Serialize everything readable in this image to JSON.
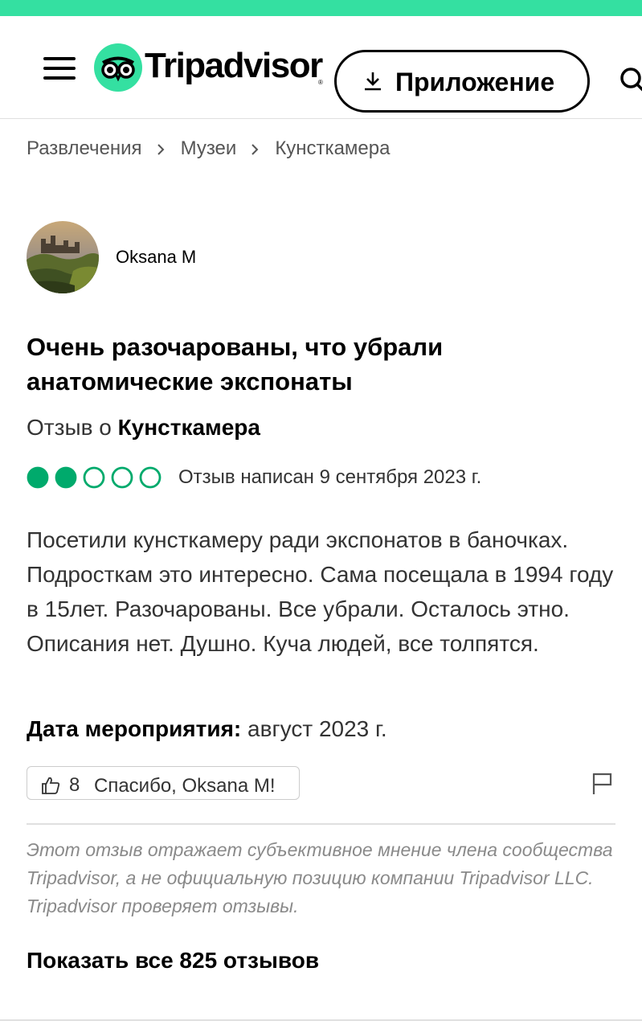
{
  "header": {
    "brand_name": "Tripadvisor",
    "trademark": "®",
    "app_button_label": "Приложение",
    "accent_color": "#34e0a1",
    "icons": [
      "menu-icon",
      "owl-logo-icon",
      "download-icon",
      "search-icon"
    ]
  },
  "breadcrumb": {
    "items": [
      "Развлечения",
      "Музеи",
      "Кунсткамера"
    ],
    "separator_icon": "chevron-right-icon"
  },
  "review": {
    "author": "Oksana M",
    "title": "Очень разочарованы, что убрали анатомические экспонаты",
    "review_of_prefix": "Отзыв о",
    "place_name": "Кунсткамера",
    "rating": {
      "value": 2,
      "max": 5,
      "filled_color": "#00aa6c"
    },
    "written_date": "Отзыв написан 9 сентября 2023 г.",
    "body": "Посетили кунсткамеру ради экспонатов в баночках. Подросткам это интересно. Сама посещала в 1994 году в 15лет. Разочарованы. Все убрали. Осталось этно. Описания нет. Душно. Куча людей, все толпятся.",
    "event_date_label": "Дата мероприятия:",
    "event_date_value": "август 2023 г.",
    "helpful_count": "8",
    "helpful_text": "Спасибо, Oksana M!"
  },
  "disclaimer": "Этот отзыв отражает субъективное мнение члена сообщества Tripadvisor, а не официальную позицию компании Tripadvisor LLC. Tripadvisor проверяет отзывы.",
  "show_all_label": "Показать все 825 отзывов"
}
